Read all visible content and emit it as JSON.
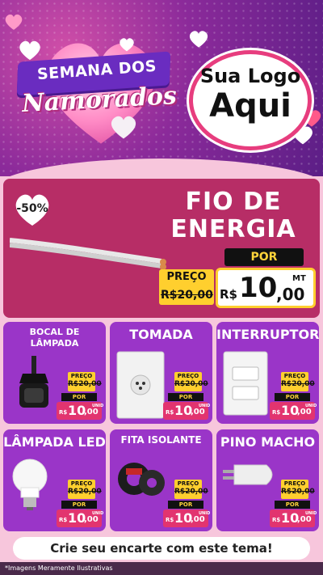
{
  "header": {
    "ribbon_text": "SEMANA DOS",
    "script_text": "Namorados",
    "logo_line1": "Sua Logo",
    "logo_line2": "Aqui"
  },
  "feature": {
    "discount": "-50%",
    "title_line1": "FIO DE",
    "title_line2": "ENERGIA",
    "por_label": "POR",
    "preco_label": "PREÇO",
    "old_price": "R$20,00",
    "currency": "R$",
    "price_int": "10",
    "price_dec": ",00",
    "unit": "MT"
  },
  "products": [
    {
      "title_line1": "BOCAL DE",
      "title_line2": "LÂMPADA",
      "icon": "lamp-socket-icon",
      "preco_label": "PREÇO",
      "old_price": "R$20,00",
      "por_label": "POR",
      "currency": "R$",
      "price_int": "10",
      "price_dec": ",00",
      "unit": "UNID"
    },
    {
      "title_line1": "TOMADA",
      "title_line2": "",
      "icon": "outlet-icon",
      "preco_label": "PREÇO",
      "old_price": "R$20,00",
      "por_label": "POR",
      "currency": "R$",
      "price_int": "10",
      "price_dec": ",00",
      "unit": "UNID"
    },
    {
      "title_line1": "INTERRUPTOR",
      "title_line2": "",
      "icon": "switch-icon",
      "preco_label": "PREÇO",
      "old_price": "R$20,00",
      "por_label": "POR",
      "currency": "R$",
      "price_int": "10",
      "price_dec": ",00",
      "unit": "UNID"
    },
    {
      "title_line1": "LÂMPADA LED",
      "title_line2": "",
      "icon": "led-bulb-icon",
      "preco_label": "PREÇO",
      "old_price": "R$20,00",
      "por_label": "POR",
      "currency": "R$",
      "price_int": "10",
      "price_dec": ",00",
      "unit": "UNID"
    },
    {
      "title_line1": "FITA ISOLANTE",
      "title_line2": "",
      "icon": "tape-icon",
      "preco_label": "PREÇO",
      "old_price": "R$20,00",
      "por_label": "POR",
      "currency": "R$",
      "price_int": "10",
      "price_dec": ",00",
      "unit": "UNID"
    },
    {
      "title_line1": "PINO MACHO",
      "title_line2": "",
      "icon": "plug-icon",
      "preco_label": "PREÇO",
      "old_price": "R$20,00",
      "por_label": "POR",
      "currency": "R$",
      "price_int": "10",
      "price_dec": ",00",
      "unit": "UNID"
    }
  ],
  "footer": {
    "cta": "Crie seu encarte com este tema!",
    "disclaimer": "*Imagens Meramente Ilustrativas"
  },
  "colors": {
    "header_purple": "#5b1e86",
    "feature_bg": "#b72d66",
    "card_bg": "#9a35c8",
    "price_red": "#e2346f",
    "tag_yellow": "#ffcf2e",
    "page_pink": "#f7c6dc"
  }
}
